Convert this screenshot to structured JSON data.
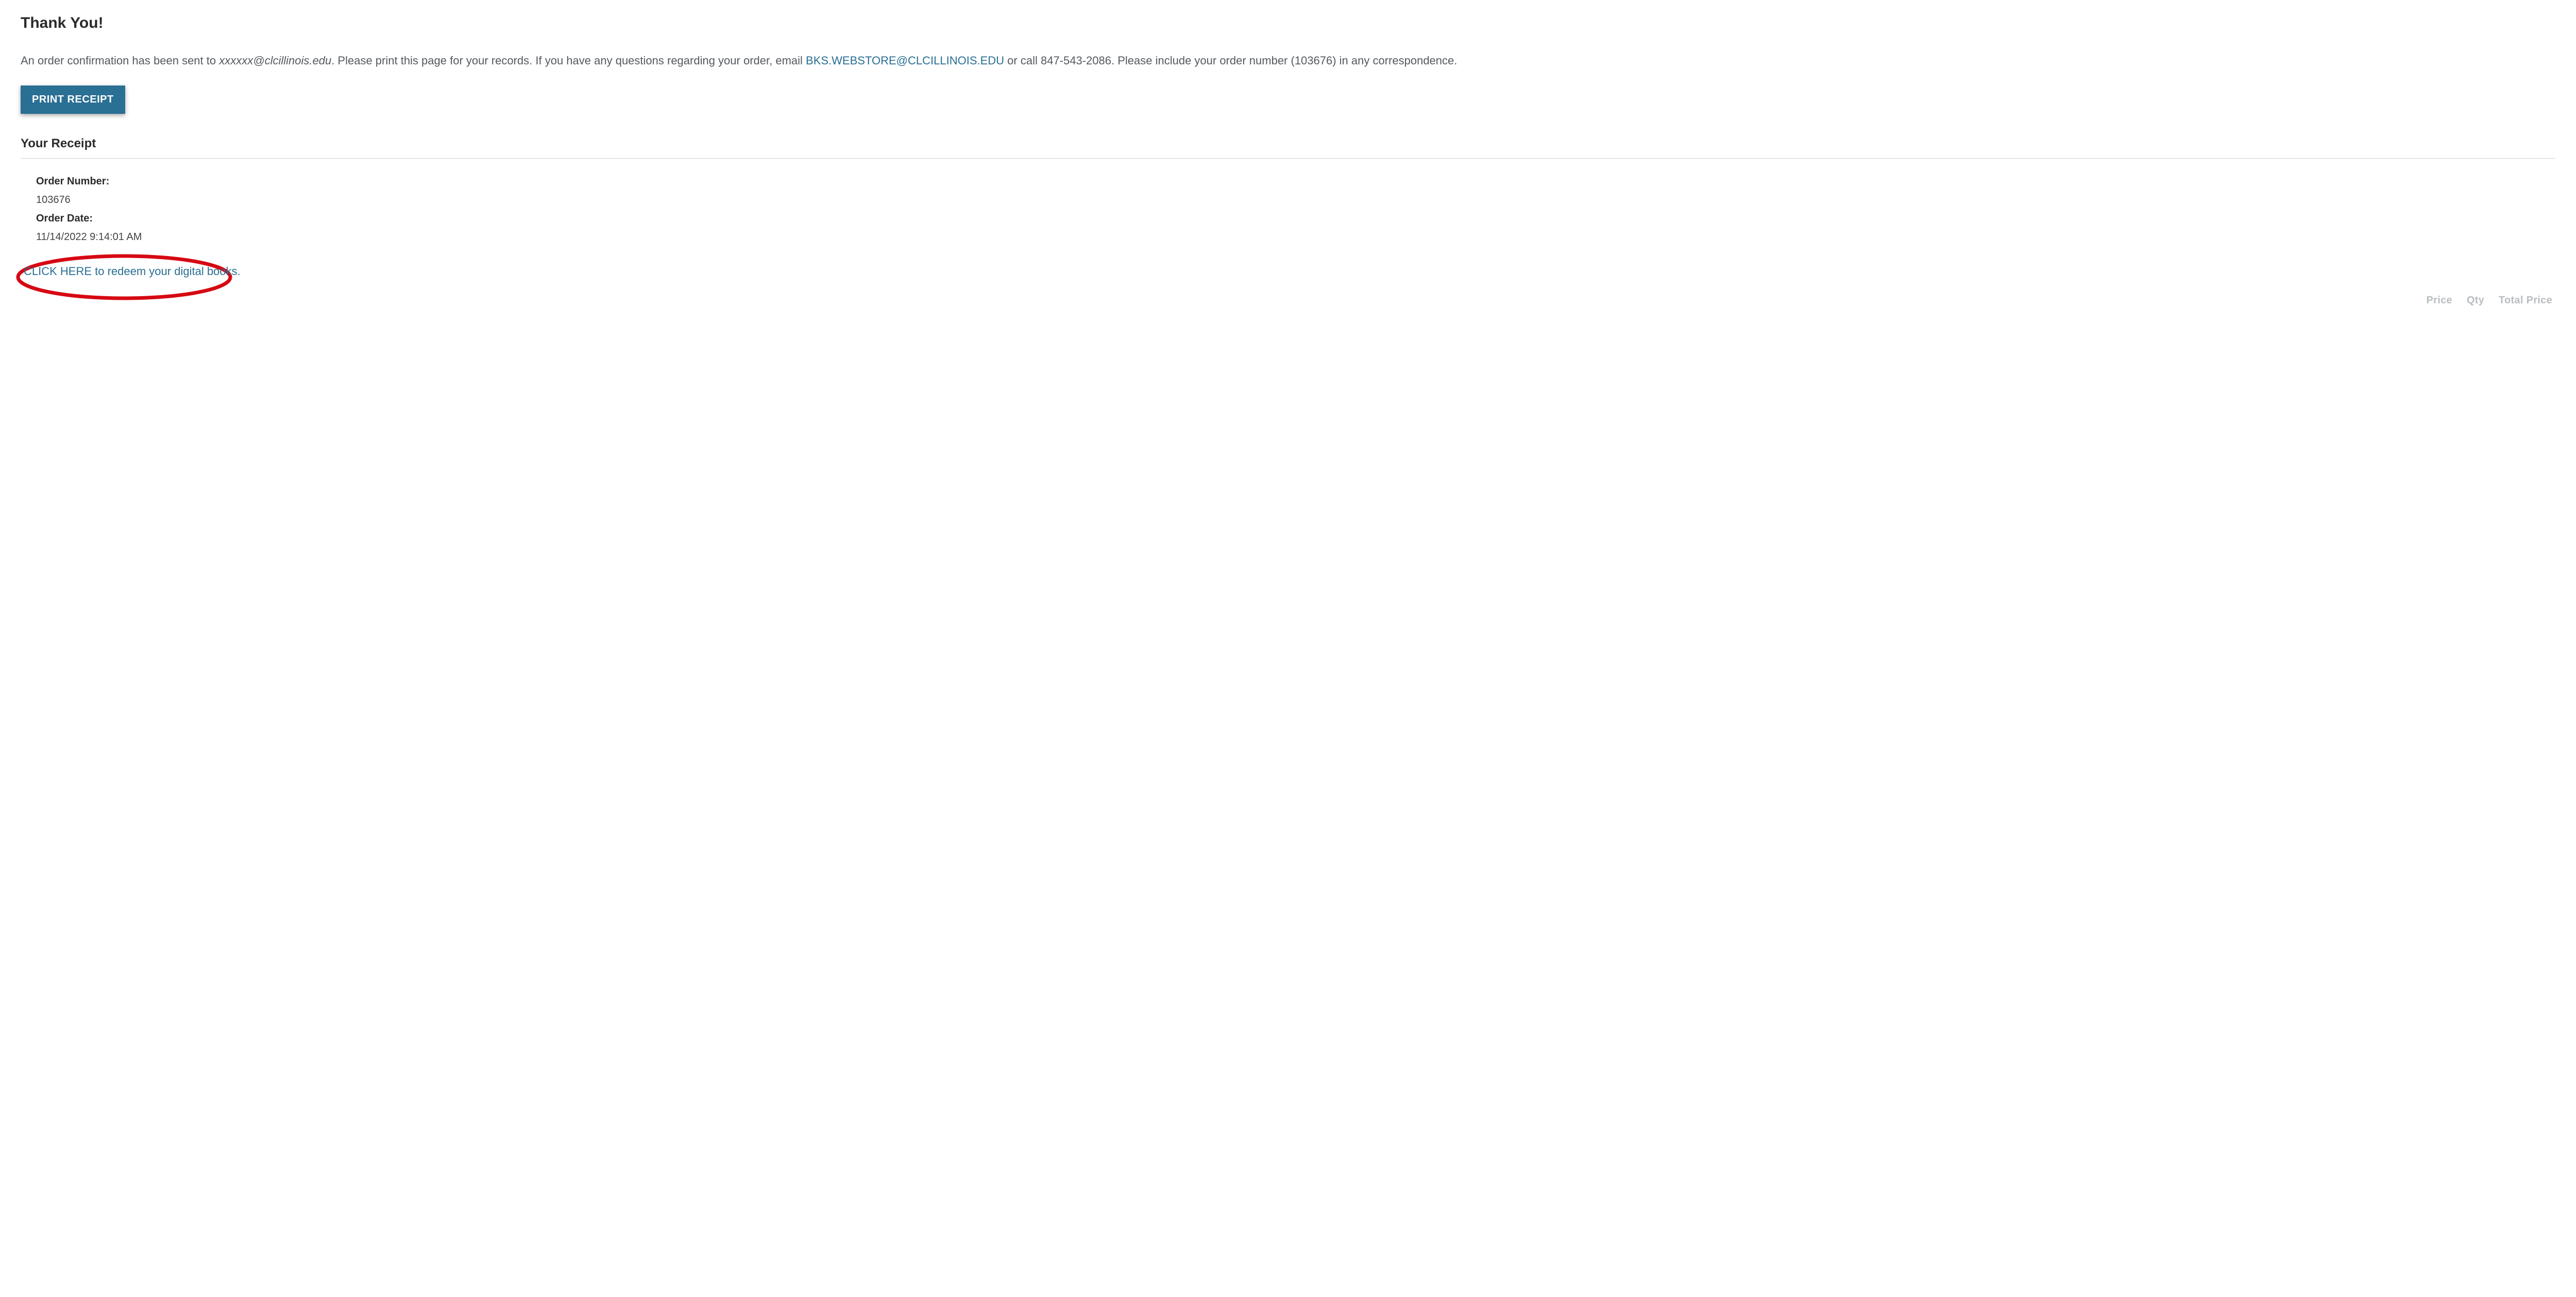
{
  "header": {
    "title": "Thank You!"
  },
  "confirmation": {
    "intro": "An order confirmation has been sent to ",
    "masked_email": "xxxxxx@clcillinois.edu",
    "after_email": ". Please print this page for your records. If you have any questions regarding your order, email ",
    "support_email": "BKS.WEBSTORE@CLCILLINOIS.EDU",
    "after_support": " or call 847-543-2086. Please include your order number (103676) in any correspondence."
  },
  "buttons": {
    "print_receipt": "PRINT RECEIPT"
  },
  "receipt": {
    "heading": "Your Receipt",
    "order_number_label": "Order Number:",
    "order_number_value": "103676",
    "order_date_label": "Order Date:",
    "order_date_value": "11/14/2022 9:14:01 AM"
  },
  "redeem": {
    "link_text": "CLICK HERE to redeem your digital books."
  },
  "columns": {
    "price": "Price",
    "qty": "Qty",
    "total_price": "Total Price"
  },
  "colors": {
    "accent": "#2a6f94",
    "annotation": "#d60812"
  }
}
